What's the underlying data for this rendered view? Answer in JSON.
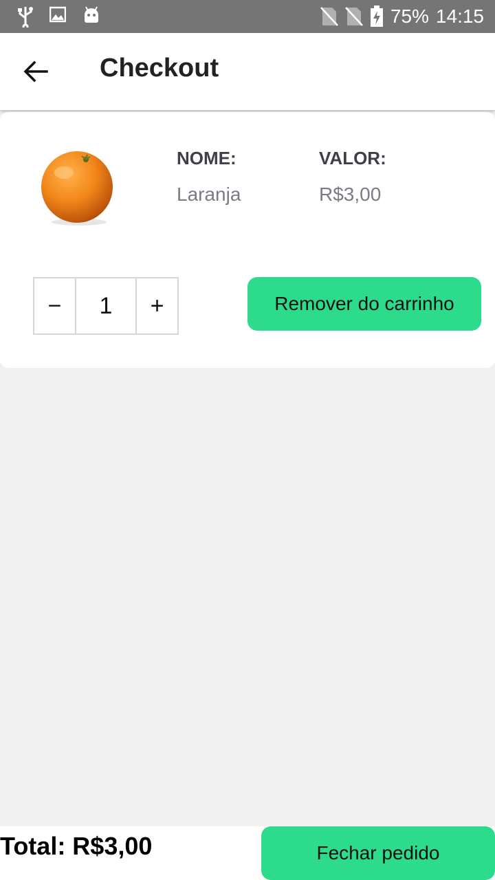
{
  "status_bar": {
    "icons": [
      "usb-icon",
      "image-icon",
      "android-icon",
      "no-sim-icon",
      "no-sim-icon",
      "battery-charging-icon"
    ],
    "battery": "75%",
    "time": "14:15"
  },
  "header": {
    "title": "Checkout",
    "back_icon": "arrow-left-icon"
  },
  "cart_item": {
    "image": "orange-image",
    "name_label": "NOME:",
    "name": "Laranja",
    "value_label": "VALOR:",
    "value": "R$3,00",
    "quantity": "1",
    "minus_label": "−",
    "plus_label": "+",
    "remove_label": "Remover do carrinho"
  },
  "footer": {
    "total": "Total: R$3,00",
    "checkout_label": "Fechar pedido"
  },
  "colors": {
    "accent": "#2ddb8c",
    "status_bar": "#757575",
    "background": "#f1f1f1"
  }
}
